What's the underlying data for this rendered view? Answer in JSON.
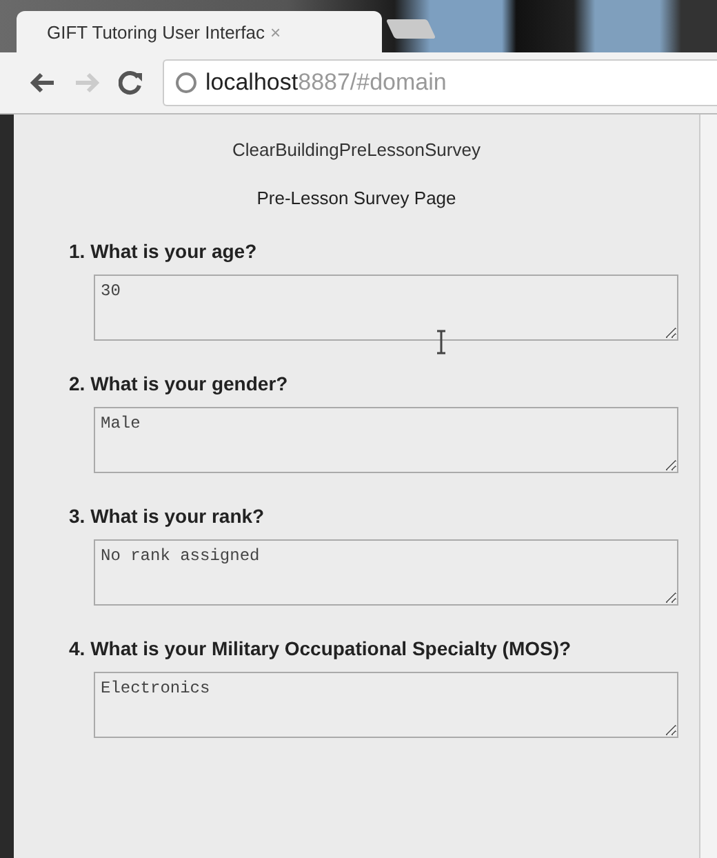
{
  "browser": {
    "tab": {
      "title": "GIFT Tutoring User Interfac",
      "close": "×",
      "selected": true
    },
    "address": {
      "host": "localhost",
      "rest": "8887/#domain"
    },
    "back_disabled": false,
    "forward_disabled": true
  },
  "page": {
    "title": "ClearBuildingPreLessonSurvey",
    "subtitle": "Pre-Lesson Survey Page",
    "questions": [
      {
        "number": "1.",
        "text": "What is your age?",
        "answer": "30"
      },
      {
        "number": "2.",
        "text": "What is your gender?",
        "answer": "Male"
      },
      {
        "number": "3.",
        "text": "What is your rank?",
        "answer": "No rank assigned"
      },
      {
        "number": "4.",
        "text": "What is your Military Occupational Specialty (MOS)?",
        "answer": "Electronics"
      }
    ]
  }
}
